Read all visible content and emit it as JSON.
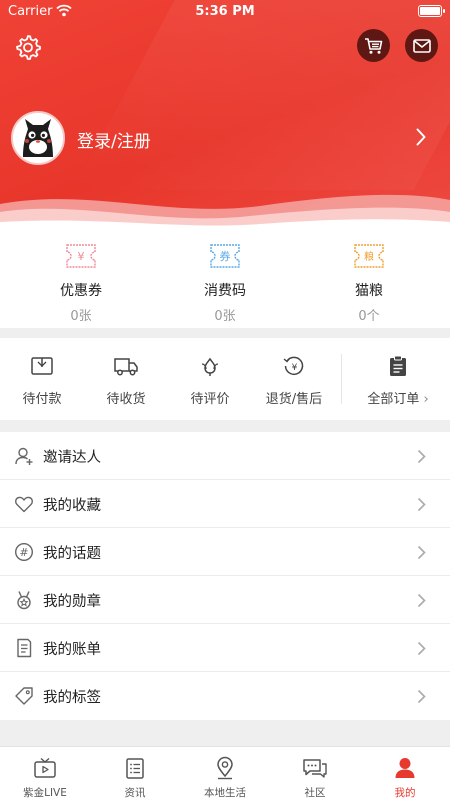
{
  "status_bar": {
    "carrier": "Carrier",
    "time": "5:36 PM"
  },
  "header": {
    "login_label": "登录/注册"
  },
  "stats": [
    {
      "icon": "coupon-icon",
      "icon_text": "¥",
      "label": "优惠券",
      "value": "0张",
      "color": "#f08a96"
    },
    {
      "icon": "voucher-icon",
      "icon_text": "券",
      "label": "消费码",
      "value": "0张",
      "color": "#5aa7e8"
    },
    {
      "icon": "cat-food-icon",
      "icon_text": "粮",
      "label": "猫粮",
      "value": "0个",
      "color": "#f0a030"
    }
  ],
  "orders": [
    {
      "icon": "wallet-icon",
      "label": "待付款"
    },
    {
      "icon": "truck-icon",
      "label": "待收货"
    },
    {
      "icon": "review-icon",
      "label": "待评价"
    },
    {
      "icon": "refund-icon",
      "label": "退货/售后"
    }
  ],
  "all_orders": {
    "icon": "clipboard-icon",
    "label": "全部订单"
  },
  "menu": [
    {
      "icon": "invite-icon",
      "label": "邀请达人"
    },
    {
      "icon": "heart-icon",
      "label": "我的收藏"
    },
    {
      "icon": "hashtag-icon",
      "label": "我的话题"
    },
    {
      "icon": "medal-icon",
      "label": "我的勋章"
    },
    {
      "icon": "bill-icon",
      "label": "我的账单"
    },
    {
      "icon": "tag-icon",
      "label": "我的标签"
    }
  ],
  "tabs": [
    {
      "icon": "live-icon",
      "label": "紫金LIVE"
    },
    {
      "icon": "news-icon",
      "label": "资讯"
    },
    {
      "icon": "location-icon",
      "label": "本地生活"
    },
    {
      "icon": "community-icon",
      "label": "社区"
    },
    {
      "icon": "profile-icon",
      "label": "我的",
      "active": true
    }
  ],
  "colors": {
    "brand_red": "#e8362b",
    "active_tab": "#e63a2e"
  }
}
